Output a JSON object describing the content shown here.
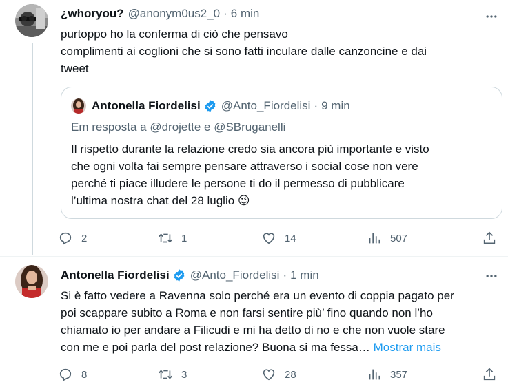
{
  "tweet1": {
    "display_name": "¿whoryou?",
    "handle": "@anonym0us2_0",
    "time": "6 min",
    "body": [
      "purtoppo ho la conferma di ciò che pensavo",
      "complimenti ai coglioni che si sono fatti inculare dalle canzoncine e dai",
      "tweet"
    ],
    "quote": {
      "display_name": "Antonella Fiordelisi",
      "handle": "@Anto_Fiordelisi",
      "time": "9 min",
      "reply_to": "Em resposta a @drojette e @SBruganelli",
      "body": [
        "Il rispetto durante la relazione credo sia ancora più importante e visto",
        "che ogni volta fai sempre pensare attraverso i social cose non vere",
        "perché ti piace illudere le persone ti do il permesso di pubblicare",
        "l’ultima nostra chat del 28 luglio"
      ],
      "emoji": "😉"
    },
    "actions": {
      "replies": "2",
      "retweets": "1",
      "likes": "14",
      "views": "507"
    }
  },
  "tweet2": {
    "display_name": "Antonella Fiordelisi",
    "handle": "@Anto_Fiordelisi",
    "time": "1 min",
    "body": [
      "Si è fatto vedere a Ravenna solo perché era un evento di coppia pagato per",
      "poi scappare subito a Roma e non farsi sentire più’ fino quando non l’ho",
      "chiamato io per andare a Filicudi e mi ha detto di no e che non vuole stare",
      "con me e poi parla del post relazione? Buona si ma fessa…"
    ],
    "show_more": "Mostrar mais",
    "actions": {
      "replies": "8",
      "retweets": "3",
      "likes": "28",
      "views": "357"
    }
  },
  "colors": {
    "verified": "#1d9bf0",
    "secondary_text": "#536471",
    "link": "#1d9bf0",
    "border": "#cfd9de"
  },
  "icons": [
    "more-icon",
    "reply-icon",
    "retweet-icon",
    "like-icon",
    "views-icon",
    "share-icon",
    "verified-badge-icon"
  ]
}
